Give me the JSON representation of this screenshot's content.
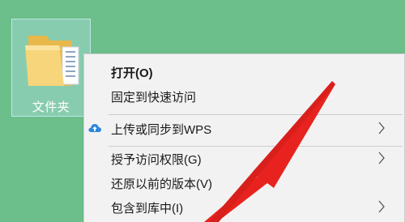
{
  "desktop": {
    "folder": {
      "label": "文件夹",
      "icon": "folder-icon"
    }
  },
  "context_menu": {
    "items": [
      {
        "label": "打开(O)",
        "bold": true
      },
      {
        "label": "固定到快速访问"
      },
      {
        "label": "上传或同步到WPS",
        "icon": "cloud-upload-icon",
        "submenu": true
      },
      {
        "label": "授予访问权限(G)",
        "submenu": true
      },
      {
        "label": "还原以前的版本(V)"
      },
      {
        "label": "包含到库中(I)",
        "submenu": true
      }
    ]
  },
  "colors": {
    "desktop_background": "#6cbf8a",
    "menu_background": "#f2f2f2",
    "annotation_arrow": "#e8231f",
    "cloud_icon": "#2f86e0"
  }
}
